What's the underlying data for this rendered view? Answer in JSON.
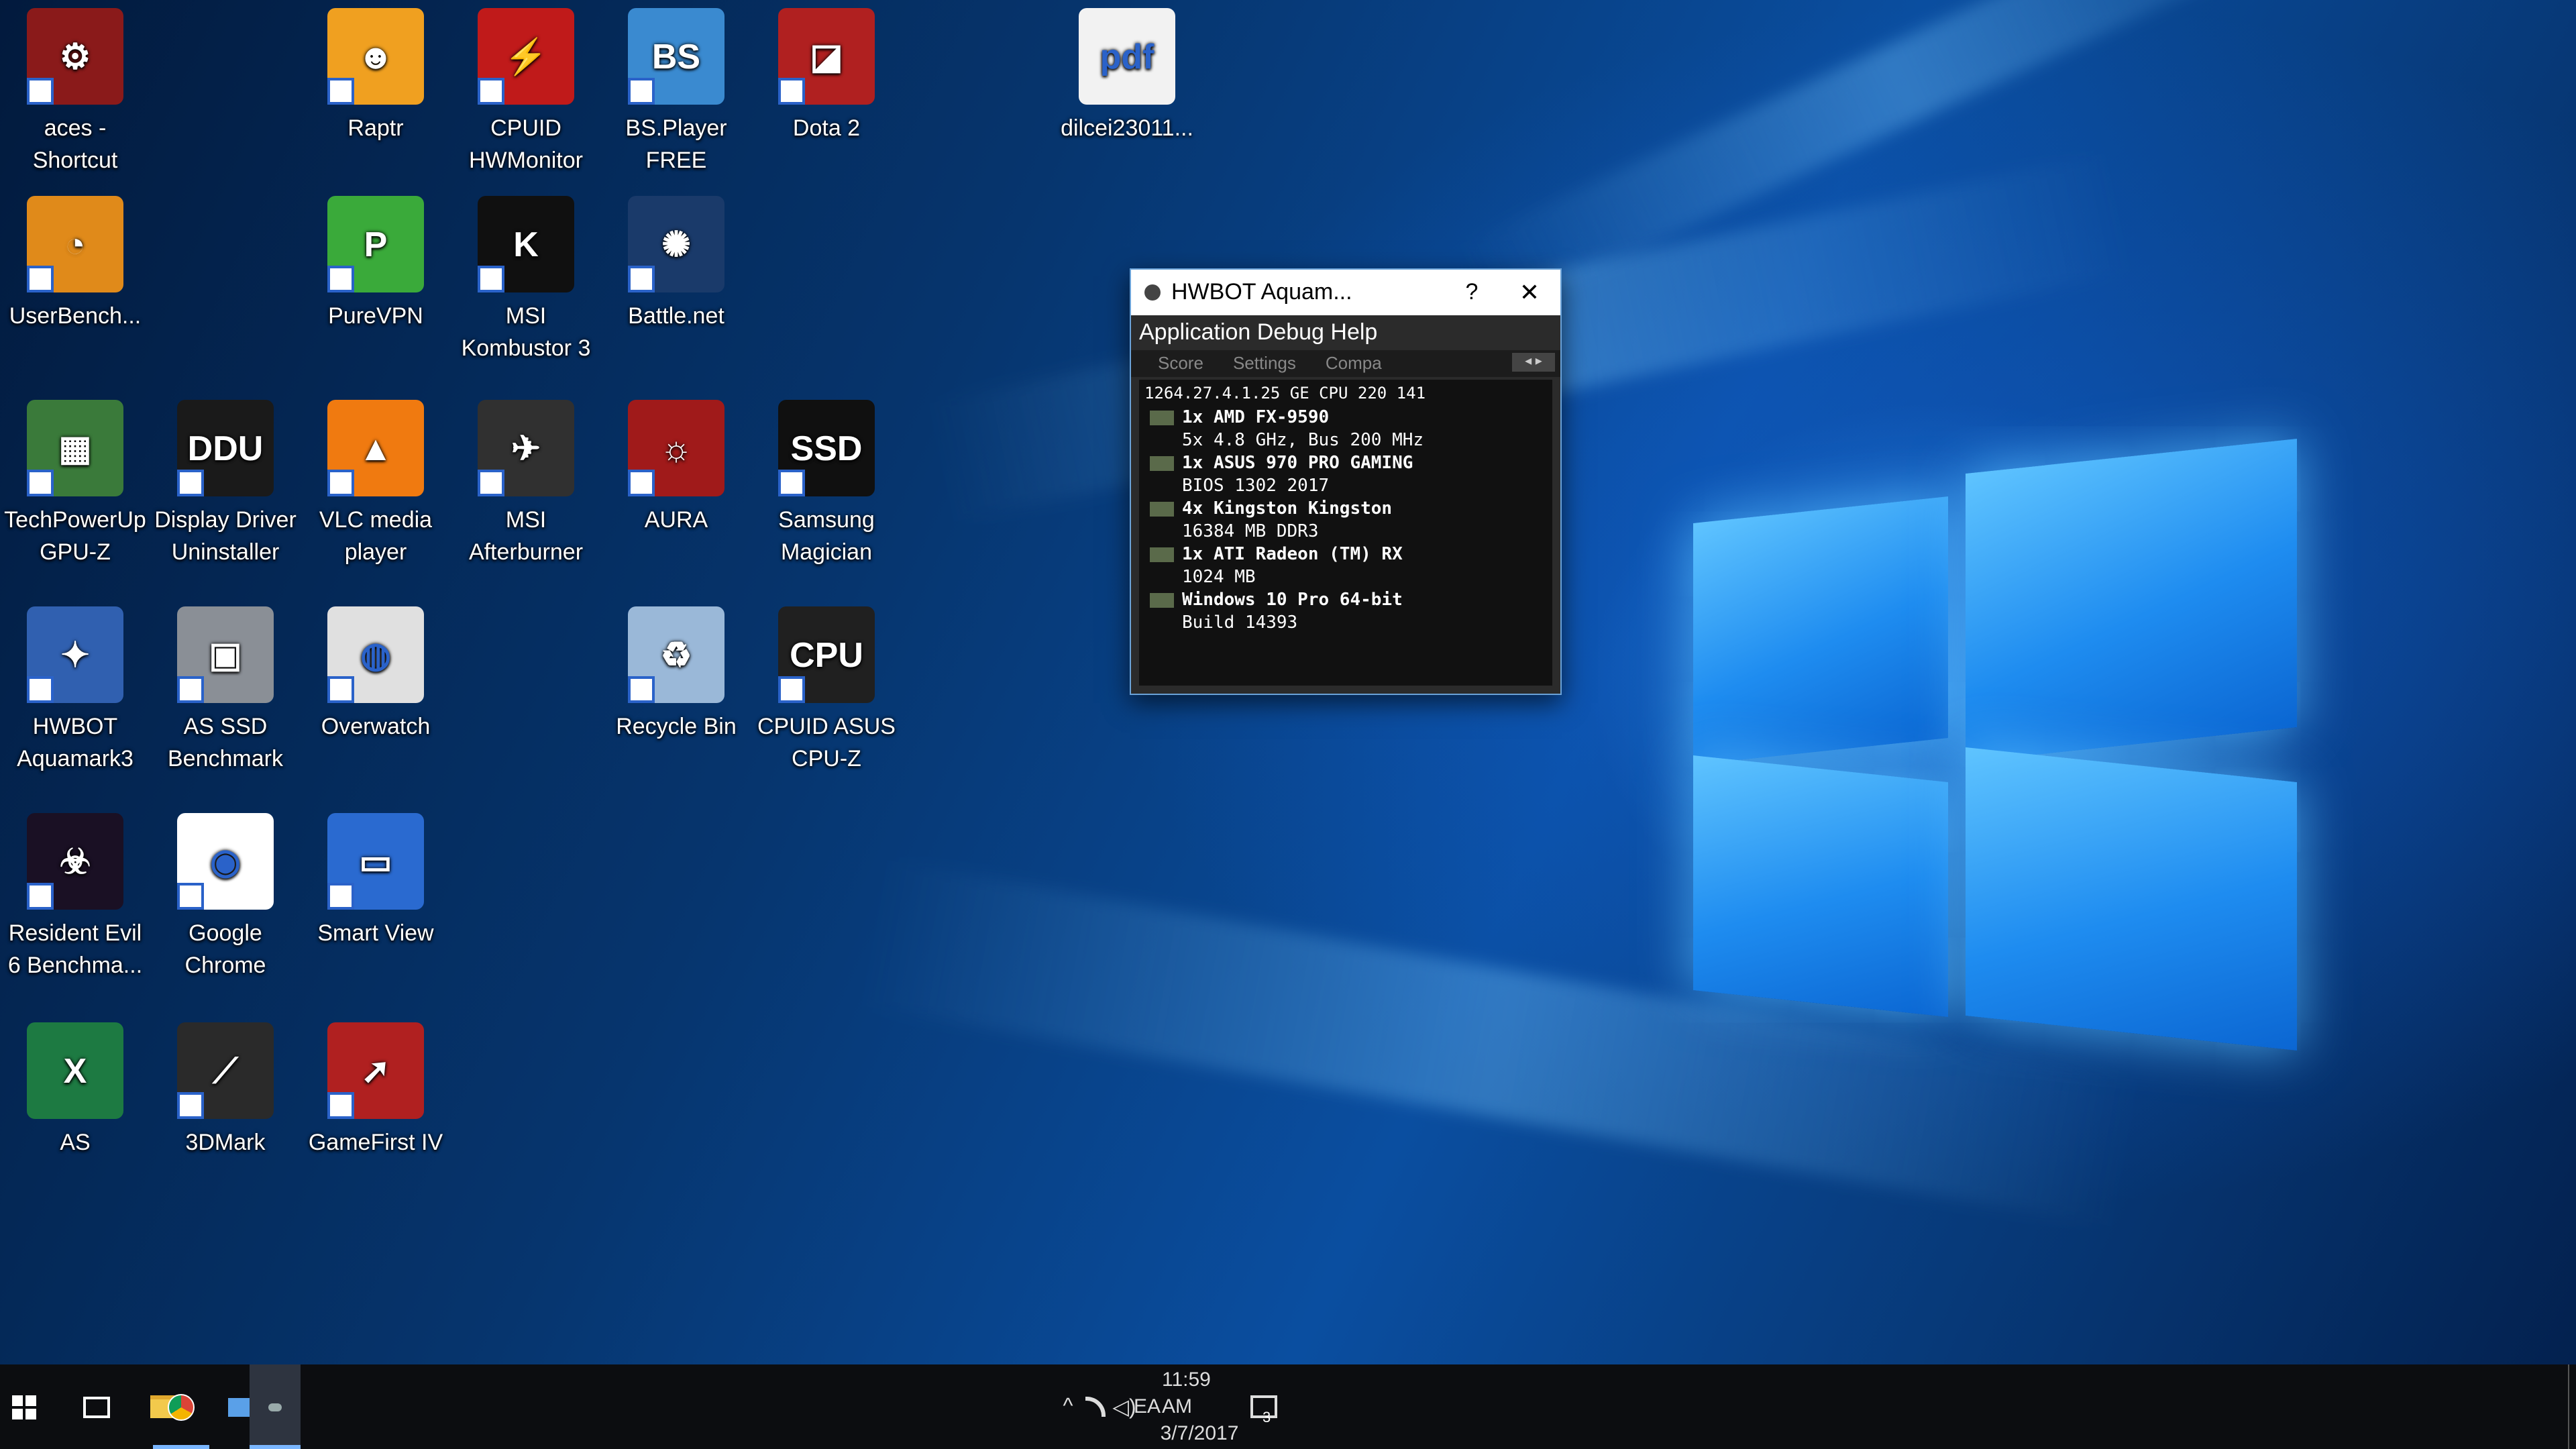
{
  "desktop": {
    "icons": [
      {
        "label": "aces -\nShortcut",
        "color": "#8a1a1a",
        "glyph": "⚙",
        "name": "aces-shortcut-icon"
      },
      {
        "label": "UserBench...",
        "color": "#e08a1a",
        "glyph": "◔",
        "name": "userbenchmark-icon"
      },
      {
        "label": "TechPowerUp\nGPU-Z",
        "color": "#3a7a3a",
        "glyph": "▦",
        "name": "gpu-z-icon"
      },
      {
        "label": "HWBOT\nAquamark3",
        "color": "#3060b0",
        "glyph": "✦",
        "name": "hwbot-aquamark3-icon"
      },
      {
        "label": "Resident Evil\n6 Benchma...",
        "color": "#1a1024",
        "glyph": "☣",
        "name": "resident-evil-icon"
      },
      {
        "label": "AS",
        "color": "#1d7a42",
        "glyph": "X",
        "name": "excel-file-icon"
      },
      {
        "label": "Display Driver\nUninstaller",
        "color": "#1a1a1a",
        "glyph": "DDU",
        "name": "ddu-icon"
      },
      {
        "label": "AS SSD\nBenchmark",
        "color": "#8a8f96",
        "glyph": "▣",
        "name": "as-ssd-icon"
      },
      {
        "label": "Google\nChrome",
        "color": "#ffffff",
        "glyph": "◉",
        "name": "chrome-icon"
      },
      {
        "label": "3DMark",
        "color": "#2a2a2a",
        "glyph": "⟋",
        "name": "3dmark-icon"
      },
      {
        "label": "Raptr",
        "color": "#f0a020",
        "glyph": "☻",
        "name": "raptr-icon"
      },
      {
        "label": "PureVPN",
        "color": "#3aaa3a",
        "glyph": "P",
        "name": "purevpn-icon"
      },
      {
        "label": "VLC media\nplayer",
        "color": "#f07a10",
        "glyph": "▲",
        "name": "vlc-icon"
      },
      {
        "label": "Overwatch",
        "color": "#e0e0e0",
        "glyph": "◍",
        "name": "overwatch-icon"
      },
      {
        "label": "Smart View",
        "color": "#2a6ad0",
        "glyph": "▭",
        "name": "smart-view-icon"
      },
      {
        "label": "GameFirst IV",
        "color": "#b02020",
        "glyph": "➚",
        "name": "gamefirst-icon"
      },
      {
        "label": "CPUID\nHWMonitor",
        "color": "#c01a1a",
        "glyph": "⚡",
        "name": "hwmonitor-icon"
      },
      {
        "label": "MSI\nKombustor 3",
        "color": "#101010",
        "glyph": "K",
        "name": "kombustor-icon"
      },
      {
        "label": "MSI\nAfterburner",
        "color": "#303030",
        "glyph": "✈",
        "name": "afterburner-icon"
      },
      {
        "label": "BS.Player\nFREE",
        "color": "#3a8ad0",
        "glyph": "BS",
        "name": "bsplayer-icon"
      },
      {
        "label": "Battle.net",
        "color": "#1a3a6a",
        "glyph": "✺",
        "name": "battlenet-icon"
      },
      {
        "label": "AURA",
        "color": "#a01a1a",
        "glyph": "☼",
        "name": "aura-icon"
      },
      {
        "label": "Recycle Bin",
        "color": "#9ab8d8",
        "glyph": "♻",
        "name": "recycle-bin-icon"
      },
      {
        "label": "Dota 2",
        "color": "#b02020",
        "glyph": "◪",
        "name": "dota2-icon"
      },
      {
        "label": "Samsung\nMagician",
        "color": "#101010",
        "glyph": "SSD",
        "name": "samsung-magician-icon"
      },
      {
        "label": "CPUID ASUS\nCPU-Z",
        "color": "#202020",
        "glyph": "CPU",
        "name": "cpuz-icon"
      },
      {
        "label": "dilcei23011...",
        "color": "#f2f2f2",
        "glyph": "pdf",
        "name": "pdf-file-icon"
      }
    ]
  },
  "hwbot_window": {
    "title": "HWBOT Aquam...",
    "help_glyph": "?",
    "close_glyph": "✕",
    "menu": "Application  Debug  Help",
    "tabs": [
      "Score",
      "Settings",
      "Compa"
    ],
    "score_line": "1264.27.4.1.25   GE  CPU   220 141",
    "rows": [
      "1x AMD FX-9590",
      "5x 4.8 GHz, Bus 200 MHz",
      "1x ASUS 970 PRO GAMING",
      "BIOS 1302 2017",
      "4x Kingston   Kingston",
      "16384 MB DDR3",
      "1x ATI Radeon (TM) RX",
      "1024 MB",
      "Windows 10 Pro 64-bit",
      "Build 14393"
    ]
  },
  "taskbar": {
    "start_label": "Start",
    "tray": {
      "chevron": "^",
      "language": "EA",
      "time": "11:59 AM",
      "date": "3/7/2017",
      "notification_count": "3"
    }
  }
}
